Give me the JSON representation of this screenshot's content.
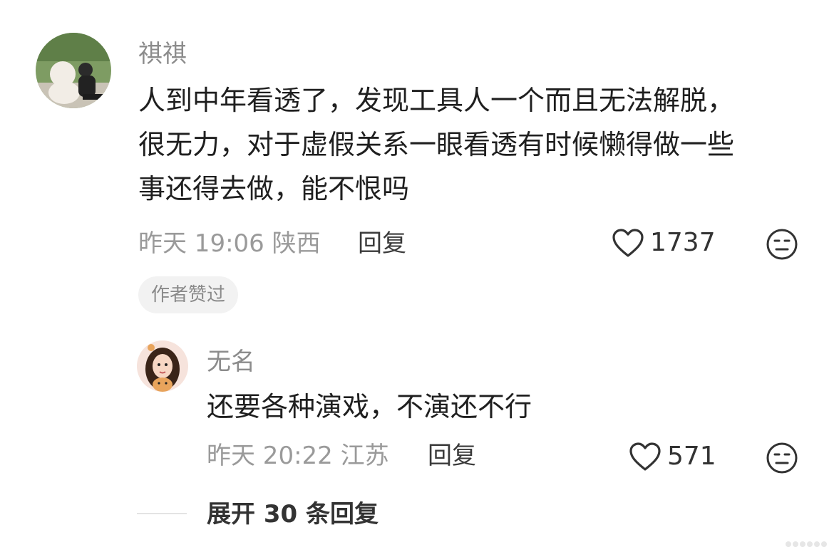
{
  "comment": {
    "username": "祺祺",
    "content_lines": [
      "人到中年看透了，发现工具人一个而且无法解脱，",
      "很无力，对于虚假关系一眼看透有时候懒得做一些",
      "事还得去做，能不恨吗"
    ],
    "meta": "昨天 19:06 陕西",
    "reply_label": "回复",
    "like_count": "1737",
    "author_badge": "作者赞过"
  },
  "reply": {
    "username": "无名",
    "content": "还要各种演戏，不演还不行",
    "meta": "昨天 20:22 江苏",
    "reply_label": "回复",
    "like_count": "571"
  },
  "expand": {
    "label": "展开 30 条回复"
  },
  "icons": {
    "like": "heart-outline-icon",
    "dislike": "meh-face-icon"
  },
  "colors": {
    "text_primary": "#1f1f1f",
    "text_secondary": "#9a9a9a",
    "badge_bg": "#f2f2f2"
  }
}
